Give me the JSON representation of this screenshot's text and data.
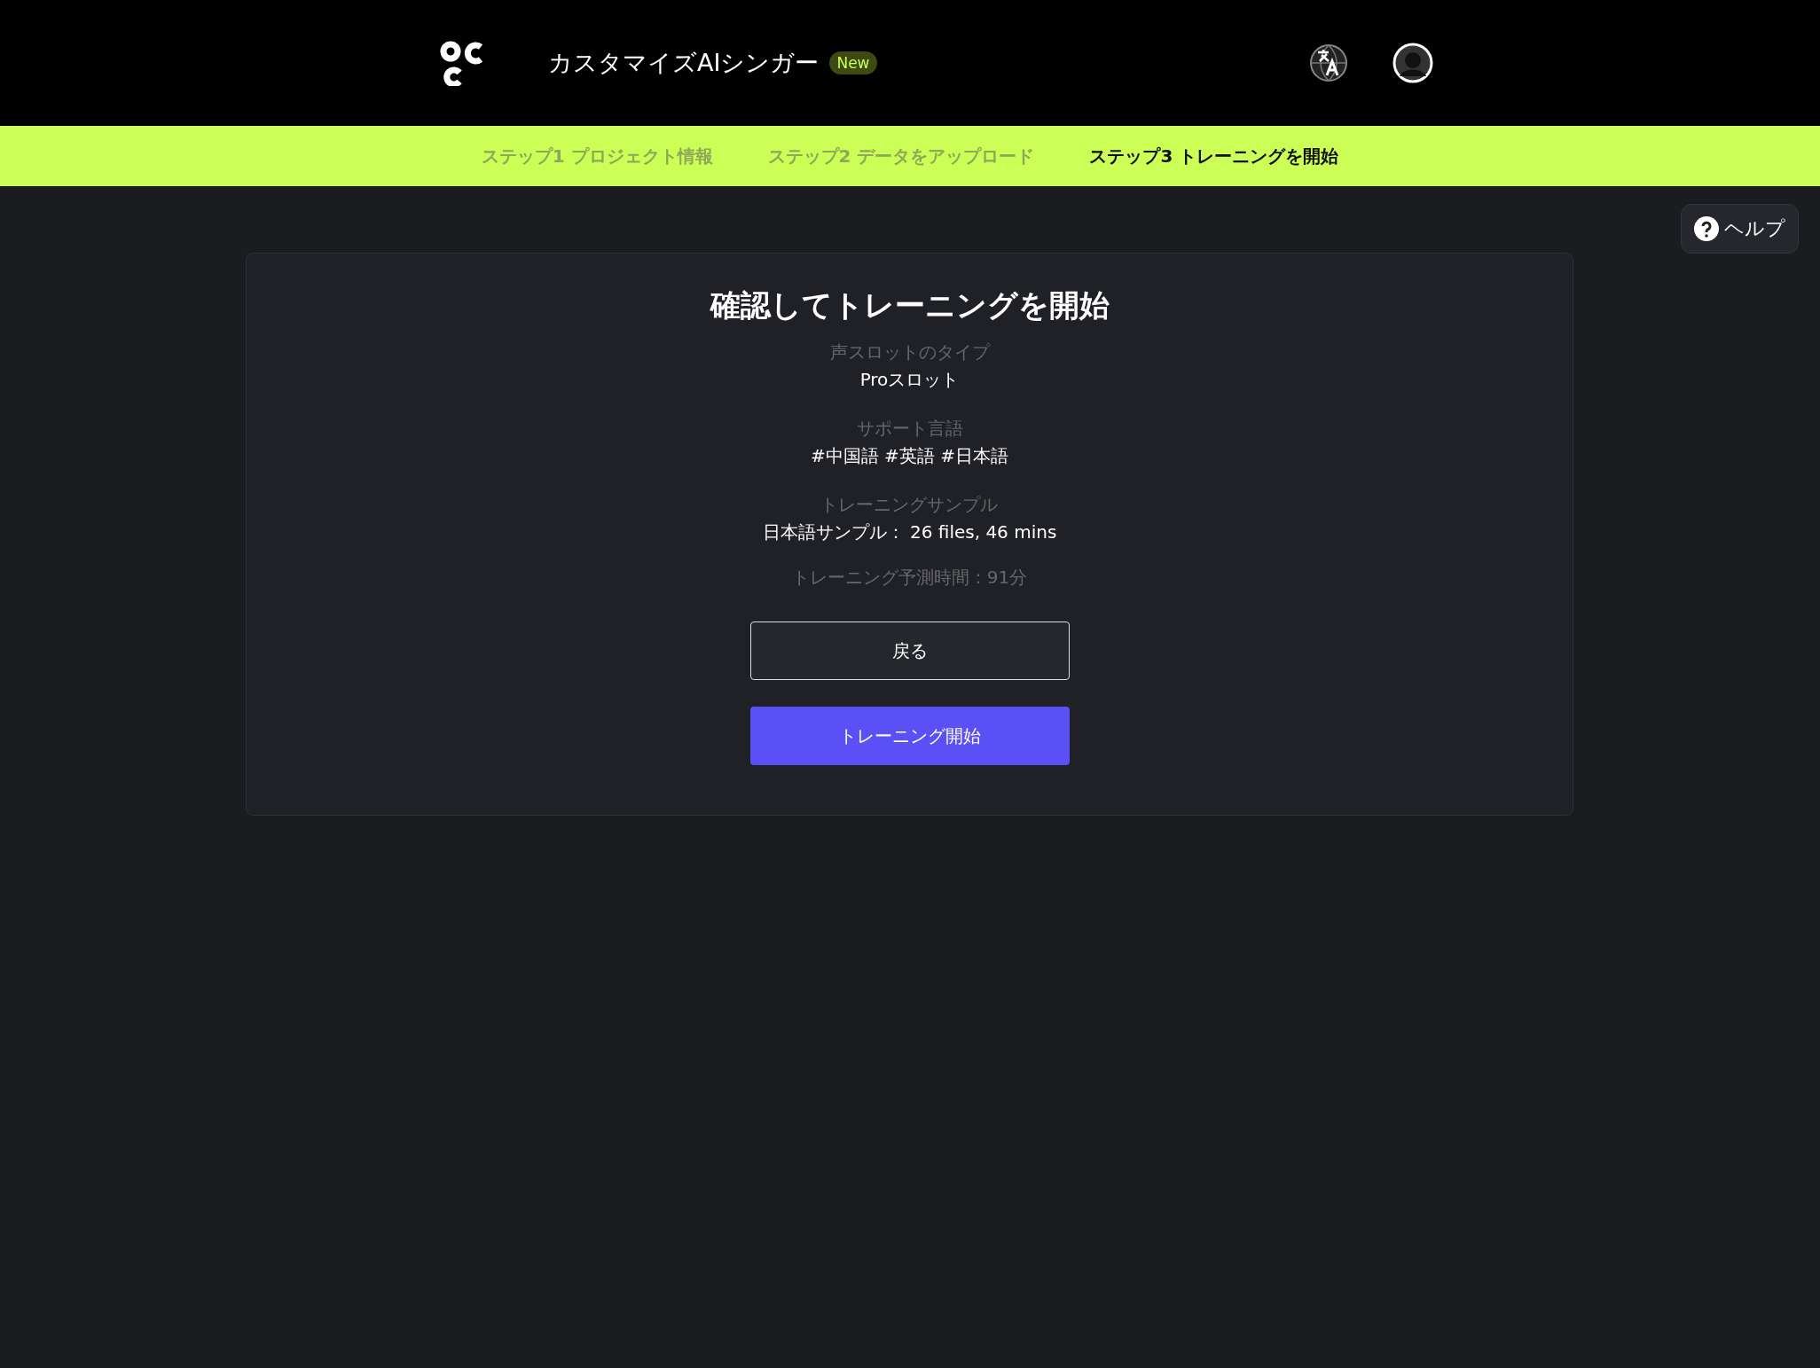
{
  "header": {
    "title": "カスタマイズAIシンガー",
    "badge": "New"
  },
  "steps": [
    {
      "label": "ステップ1 プロジェクト情報",
      "selected": false
    },
    {
      "label": "ステップ2 データをアップロード",
      "selected": false
    },
    {
      "label": "ステップ3 トレーニングを開始",
      "selected": true
    }
  ],
  "help_button": {
    "label": "ヘルプ"
  },
  "card": {
    "title": "確認してトレーニングを開始",
    "fields": [
      {
        "label": "声スロットのタイプ",
        "value": "Proスロット"
      },
      {
        "label": "サポート言語",
        "value": "#中国語 #英語 #日本語"
      },
      {
        "label": "トレーニングサンプル",
        "value": "日本語サンプル： 26 files, 46 mins"
      }
    ],
    "estimate": "トレーニング予測時間：91分",
    "back_button": "戻る",
    "start_button": "トレーニング開始"
  }
}
